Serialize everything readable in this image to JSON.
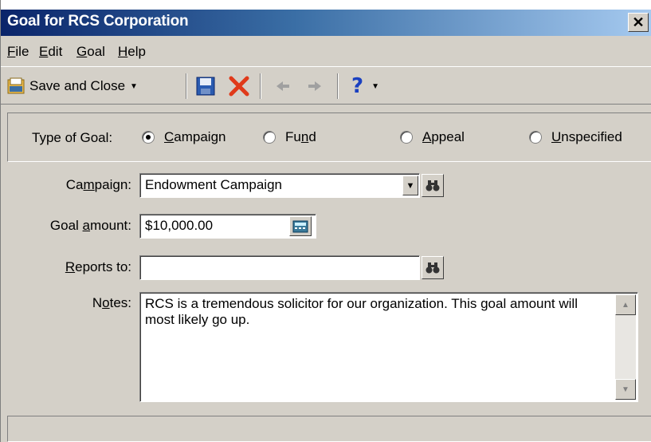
{
  "window": {
    "title": "Goal for RCS Corporation"
  },
  "menu": [
    {
      "label": "File"
    },
    {
      "label": "Edit"
    },
    {
      "label": "Goal"
    },
    {
      "label": "Help"
    }
  ],
  "toolbar": {
    "save_and_close_label": "Save and Close"
  },
  "goal_type": {
    "label": "Type of Goal:",
    "options": [
      {
        "label": "Campaign",
        "selected": true
      },
      {
        "label": "Fund",
        "selected": false
      },
      {
        "label": "Appeal",
        "selected": false
      },
      {
        "label": "Unspecified",
        "selected": false
      }
    ]
  },
  "form": {
    "campaign_label": "Campaign:",
    "campaign_value": "Endowment Campaign",
    "goal_amount_label": "Goal amount:",
    "goal_amount_value": "$10,000.00",
    "reports_to_label": "Reports to:",
    "reports_to_value": "",
    "notes_label": "Notes:",
    "notes_value": "RCS is a tremendous solicitor for our organization.  This goal amount will most likely go up."
  },
  "colors": {
    "titlebar_start": "#0a246a",
    "titlebar_end": "#a6caf0",
    "window_bg": "#d4d0c8"
  }
}
